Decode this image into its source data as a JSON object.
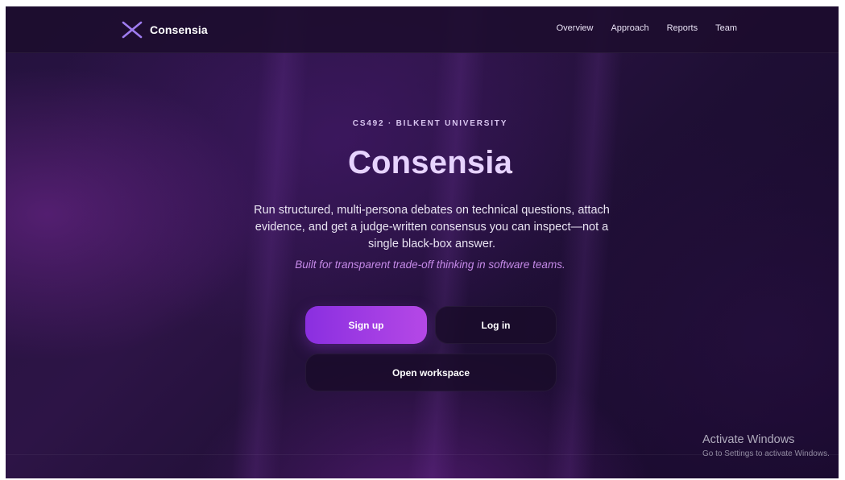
{
  "brand": {
    "name": "Consensia",
    "logo_icon": "x-logo-icon",
    "logo_color": "#9f7cf0"
  },
  "nav": {
    "links": [
      {
        "label": "Overview"
      },
      {
        "label": "Approach"
      },
      {
        "label": "Reports"
      },
      {
        "label": "Team"
      }
    ]
  },
  "hero": {
    "eyebrow": "CS492 · BILKENT UNIVERSITY",
    "title": "Consensia",
    "description": "Run structured, multi-persona debates on technical questions, attach evidence, and get a judge-written consensus you can inspect—not a single black-box answer.",
    "tagline": "Built for transparent trade-off thinking in software teams."
  },
  "actions": {
    "signup_label": "Sign up",
    "login_label": "Log in",
    "workspace_label": "Open workspace"
  },
  "watermark": {
    "title": "Activate Windows",
    "subtitle": "Go to Settings to activate Windows."
  },
  "colors": {
    "accent_gradient_start": "#8a2fe0",
    "accent_gradient_end": "#b548e6",
    "title_color": "#e7d3ff",
    "tagline_color": "#c58ae8",
    "background": "#24123e"
  }
}
